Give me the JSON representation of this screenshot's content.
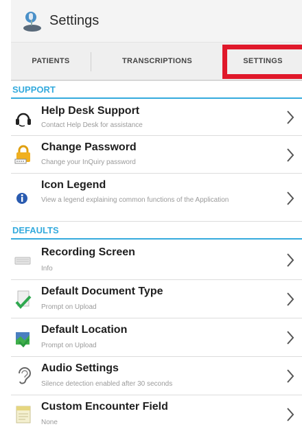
{
  "title_bar": {
    "title": "Settings"
  },
  "tabs": [
    {
      "label": "PATIENTS"
    },
    {
      "label": "TRANSCRIPTIONS"
    },
    {
      "label": "SETTINGS"
    }
  ],
  "support": {
    "header": "SUPPORT",
    "items": [
      {
        "title": "Help Desk Support",
        "subtitle": "Contact Help Desk for assistance",
        "icon": "headset-icon"
      },
      {
        "title": "Change Password",
        "subtitle": "Change your InQuiry password",
        "icon": "lock-icon"
      },
      {
        "title": "Icon Legend",
        "subtitle": "View a legend explaining common functions of the Application",
        "icon": "info-icon"
      }
    ]
  },
  "defaults": {
    "header": "DEFAULTS",
    "items": [
      {
        "title": "Recording Screen",
        "subtitle": "Info",
        "icon": "keyboard-icon"
      },
      {
        "title": "Default Document Type",
        "subtitle": "Prompt on Upload",
        "icon": "document-check-icon"
      },
      {
        "title": "Default Location",
        "subtitle": "Prompt on Upload",
        "icon": "location-icon"
      },
      {
        "title": "Audio Settings",
        "subtitle": "Silence detection enabled after 30 seconds",
        "icon": "ear-icon"
      },
      {
        "title": "Custom Encounter Field",
        "subtitle": "None",
        "icon": "note-icon"
      }
    ]
  },
  "colors": {
    "accent": "#33aadd",
    "highlight": "#e0182a"
  }
}
